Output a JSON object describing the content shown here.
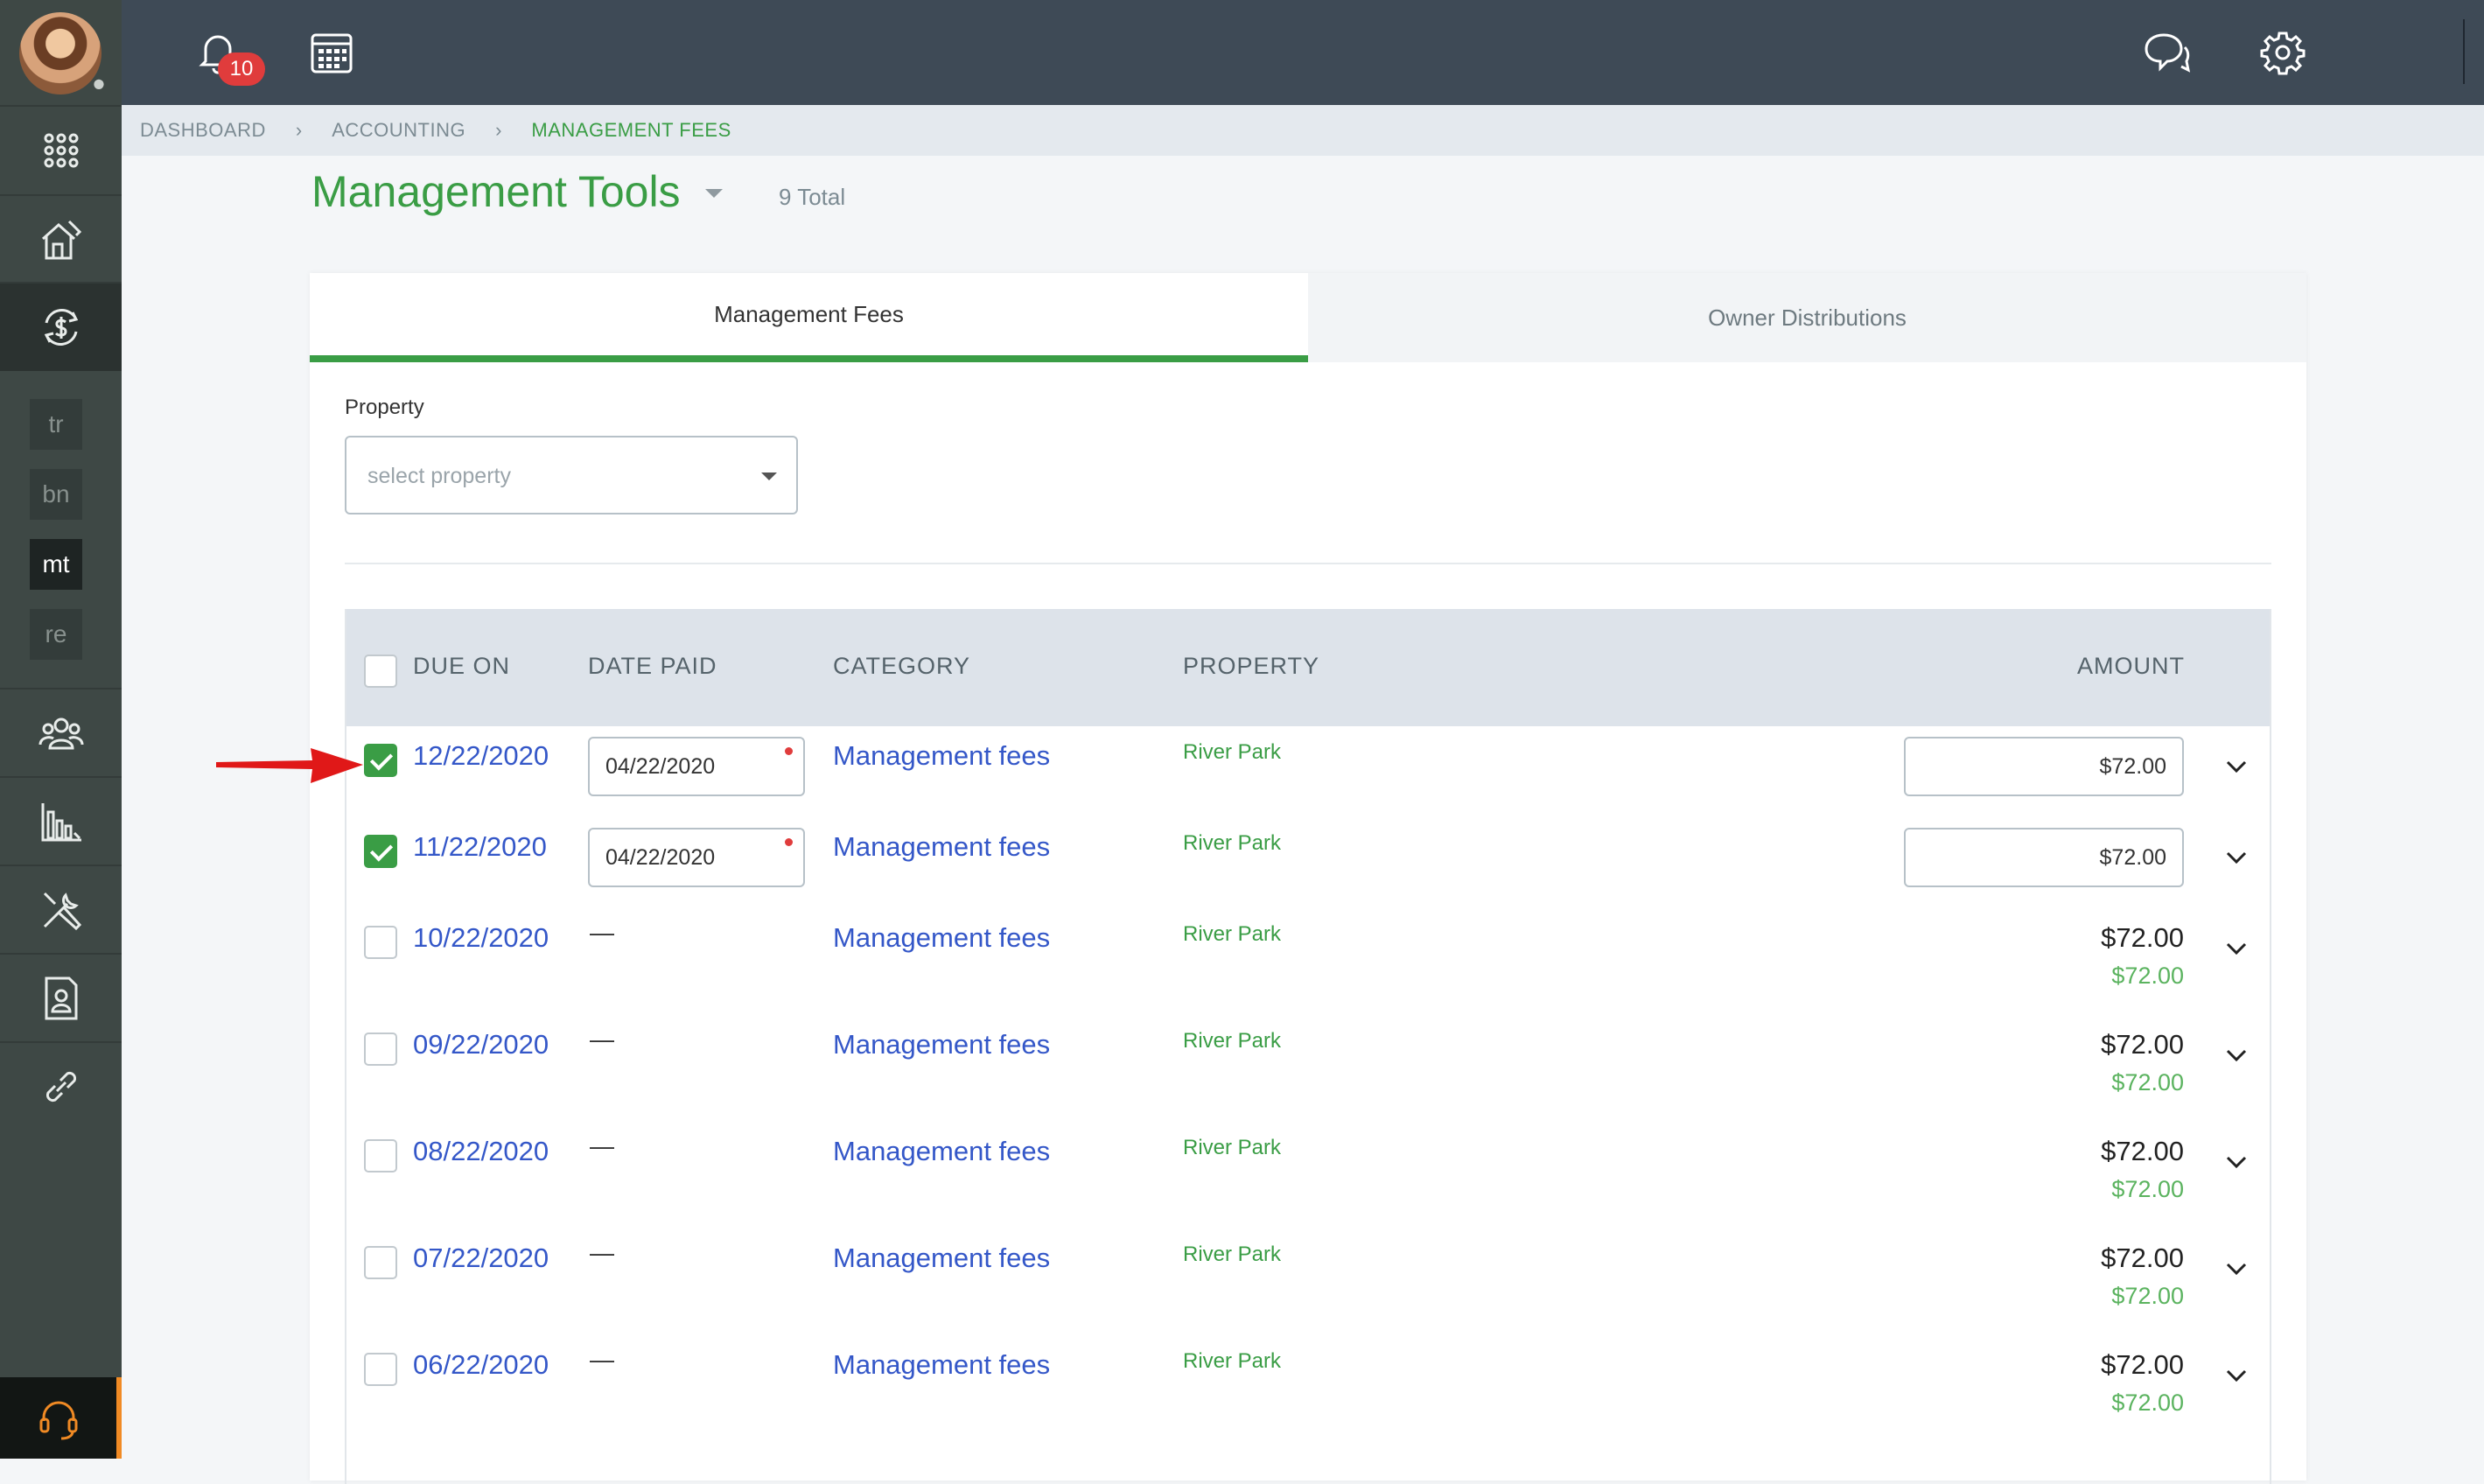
{
  "topbar": {
    "notification_count": "10",
    "icons": [
      "bell-icon",
      "calendar-icon",
      "chat-icon",
      "gear-icon",
      "logout-icon"
    ]
  },
  "sidebar": {
    "tags": [
      "tr",
      "bn",
      "mt",
      "re"
    ],
    "icons": [
      "grid-icon",
      "house-icon",
      "money-cycle-icon",
      "people-icon",
      "bar-chart-icon",
      "tools-icon",
      "contact-icon",
      "link-icon",
      "headset-icon"
    ]
  },
  "breadcrumb": [
    "DASHBOARD",
    "ACCOUNTING",
    "MANAGEMENT FEES"
  ],
  "header": {
    "title": "Management Tools",
    "total": "9 Total"
  },
  "tabs": [
    "Management Fees",
    "Owner Distributions"
  ],
  "filter": {
    "label": "Property",
    "placeholder": "select property"
  },
  "table": {
    "columns": [
      "DUE ON",
      "DATE PAID",
      "CATEGORY",
      "PROPERTY",
      "AMOUNT"
    ],
    "rows": [
      {
        "due": "12/22/2020",
        "paid": "04/22/2020",
        "category": "Management fees",
        "property": "River Park",
        "amount": "$72.00",
        "checked": true
      },
      {
        "due": "11/22/2020",
        "paid": "04/22/2020",
        "category": "Management fees",
        "property": "River Park",
        "amount": "$72.00",
        "checked": true
      },
      {
        "due": "10/22/2020",
        "paid": "—",
        "category": "Management fees",
        "property": "River Park",
        "amount": "$72.00",
        "amount_sub": "$72.00",
        "checked": false
      },
      {
        "due": "09/22/2020",
        "paid": "—",
        "category": "Management fees",
        "property": "River Park",
        "amount": "$72.00",
        "amount_sub": "$72.00",
        "checked": false
      },
      {
        "due": "08/22/2020",
        "paid": "—",
        "category": "Management fees",
        "property": "River Park",
        "amount": "$72.00",
        "amount_sub": "$72.00",
        "checked": false
      },
      {
        "due": "07/22/2020",
        "paid": "—",
        "category": "Management fees",
        "property": "River Park",
        "amount": "$72.00",
        "amount_sub": "$72.00",
        "checked": false
      },
      {
        "due": "06/22/2020",
        "paid": "—",
        "category": "Management fees",
        "property": "River Park",
        "amount": "$72.00",
        "amount_sub": "$72.00",
        "checked": false
      }
    ]
  },
  "colors": {
    "accent": "#3a9d45",
    "link": "#3457c8",
    "topbar": "#3e4a56",
    "sidebar": "#3e4845",
    "alert": "#e03c3c"
  }
}
